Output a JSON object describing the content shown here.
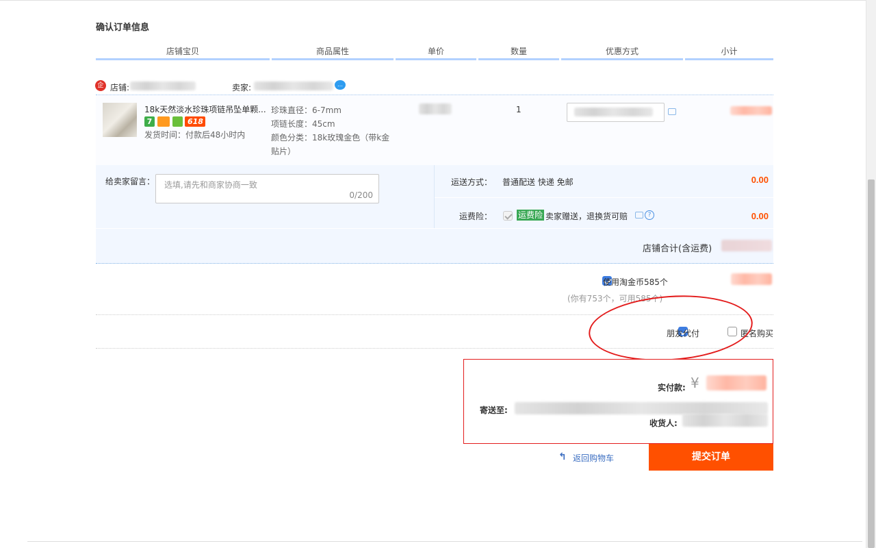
{
  "page": {
    "title": "确认订单信息"
  },
  "columns": [
    "店铺宝贝",
    "商品属性",
    "单价",
    "数量",
    "优惠方式",
    "小计"
  ],
  "shop": {
    "shop_label": "店铺:",
    "seller_label": "卖家:"
  },
  "item": {
    "name": "18k天然淡水珍珠项链吊坠单颗...",
    "ship_time": "发货时间：付款后48小时内",
    "badges": [
      "7",
      "618"
    ],
    "attrs": [
      "珍珠直径：6-7mm",
      "项链长度：45cm",
      "颜色分类：18k玫瑰金色（带k金",
      "贴片）"
    ],
    "quantity": "1"
  },
  "message": {
    "label": "给卖家留言：",
    "placeholder": "选填,请先和商家协商一致",
    "counter": "0/200"
  },
  "shipping": {
    "method_label": "运送方式：",
    "method_value": "普通配送 快递 免邮",
    "method_price": "0.00",
    "insurance_label": "运费险：",
    "insurance_tag": "运费险",
    "insurance_text": "卖家赠送，退换货可赔",
    "insurance_price": "0.00"
  },
  "shop_total_label": "店铺合计(含运费)",
  "coins": {
    "label": "使用淘金币585个",
    "note": "(你有753个，可用585个)",
    "checked": true
  },
  "options": {
    "friend_pay": "朋友代付",
    "friend_pay_checked": true,
    "anonymous": "匿名购买",
    "anonymous_checked": false
  },
  "summary": {
    "paid_label": "实付款:",
    "currency": "¥",
    "ship_to_label": "寄送至:",
    "receiver_label": "收货人:"
  },
  "actions": {
    "back": "返回购物车",
    "submit": "提交订单"
  },
  "colors": {
    "accent": "#ff5000",
    "highlight": "#e31c1c",
    "table_bg": "#f2f7ff"
  }
}
